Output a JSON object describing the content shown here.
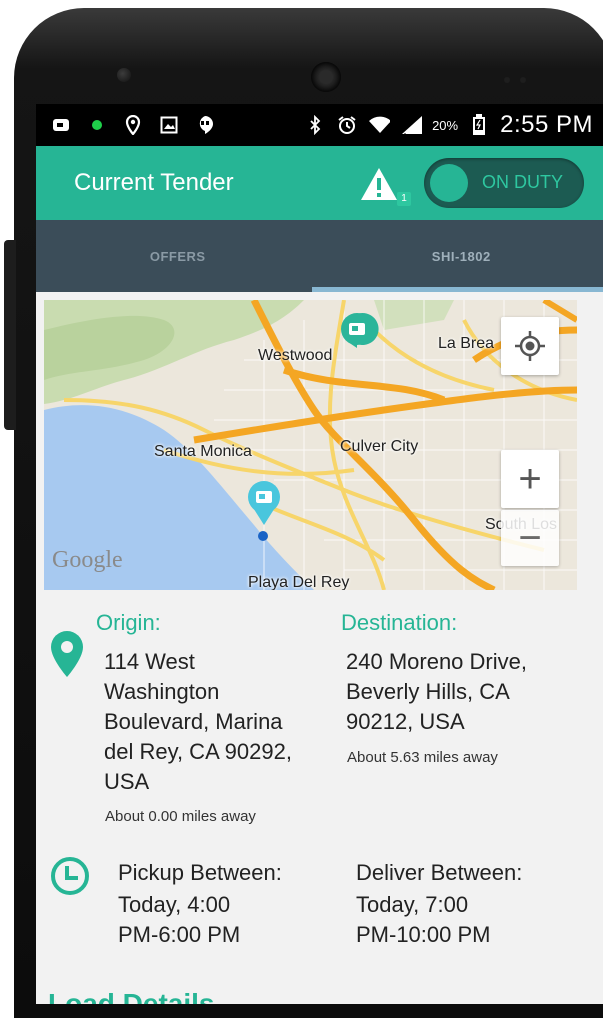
{
  "status_bar": {
    "battery_percent": "20%",
    "time": "2:55 PM",
    "icons_left": [
      "notification-icon",
      "green-dot-icon",
      "location-icon",
      "image-icon",
      "hangouts-icon"
    ],
    "icons_right": [
      "bluetooth-icon",
      "alarm-icon",
      "wifi-icon",
      "signal-icon",
      "battery-icon"
    ]
  },
  "app_bar": {
    "title": "Current Tender",
    "alert_count": "1",
    "duty_toggle_label": "ON DUTY"
  },
  "tabs": [
    {
      "label": "OFFERS",
      "active": false
    },
    {
      "label": "SHI-1802",
      "active": true
    }
  ],
  "map": {
    "labels": {
      "westwood": "Westwood",
      "la_brea": "La Brea",
      "santa_monica": "Santa Monica",
      "culver_city": "Culver City",
      "south_los": "South Los",
      "playa": "Playa Del Rey"
    },
    "attribution": "Google",
    "zoom_in": "+",
    "zoom_out": "−"
  },
  "origin": {
    "heading": "Origin:",
    "address_lines": [
      "114 West",
      "Washington",
      "Boulevard, Marina",
      "del Rey, CA 90292,",
      "USA"
    ],
    "distance": "About 0.00 miles away"
  },
  "destination": {
    "heading": "Destination:",
    "address_lines": [
      "240 Moreno Drive,",
      "Beverly Hills, CA",
      "90212, USA"
    ],
    "distance": "About 5.63 miles away"
  },
  "pickup": {
    "heading": "Pickup Between:",
    "lines": [
      "Today, 4:00",
      "PM-6:00 PM"
    ]
  },
  "delivery": {
    "heading": "Deliver Between:",
    "lines": [
      "Today, 7:00",
      "PM-10:00 PM"
    ]
  },
  "section_title": "Load Details",
  "colors": {
    "accent": "#26b595",
    "tab_bar": "#3b4d59",
    "tab_indicator": "#88b7d2"
  }
}
